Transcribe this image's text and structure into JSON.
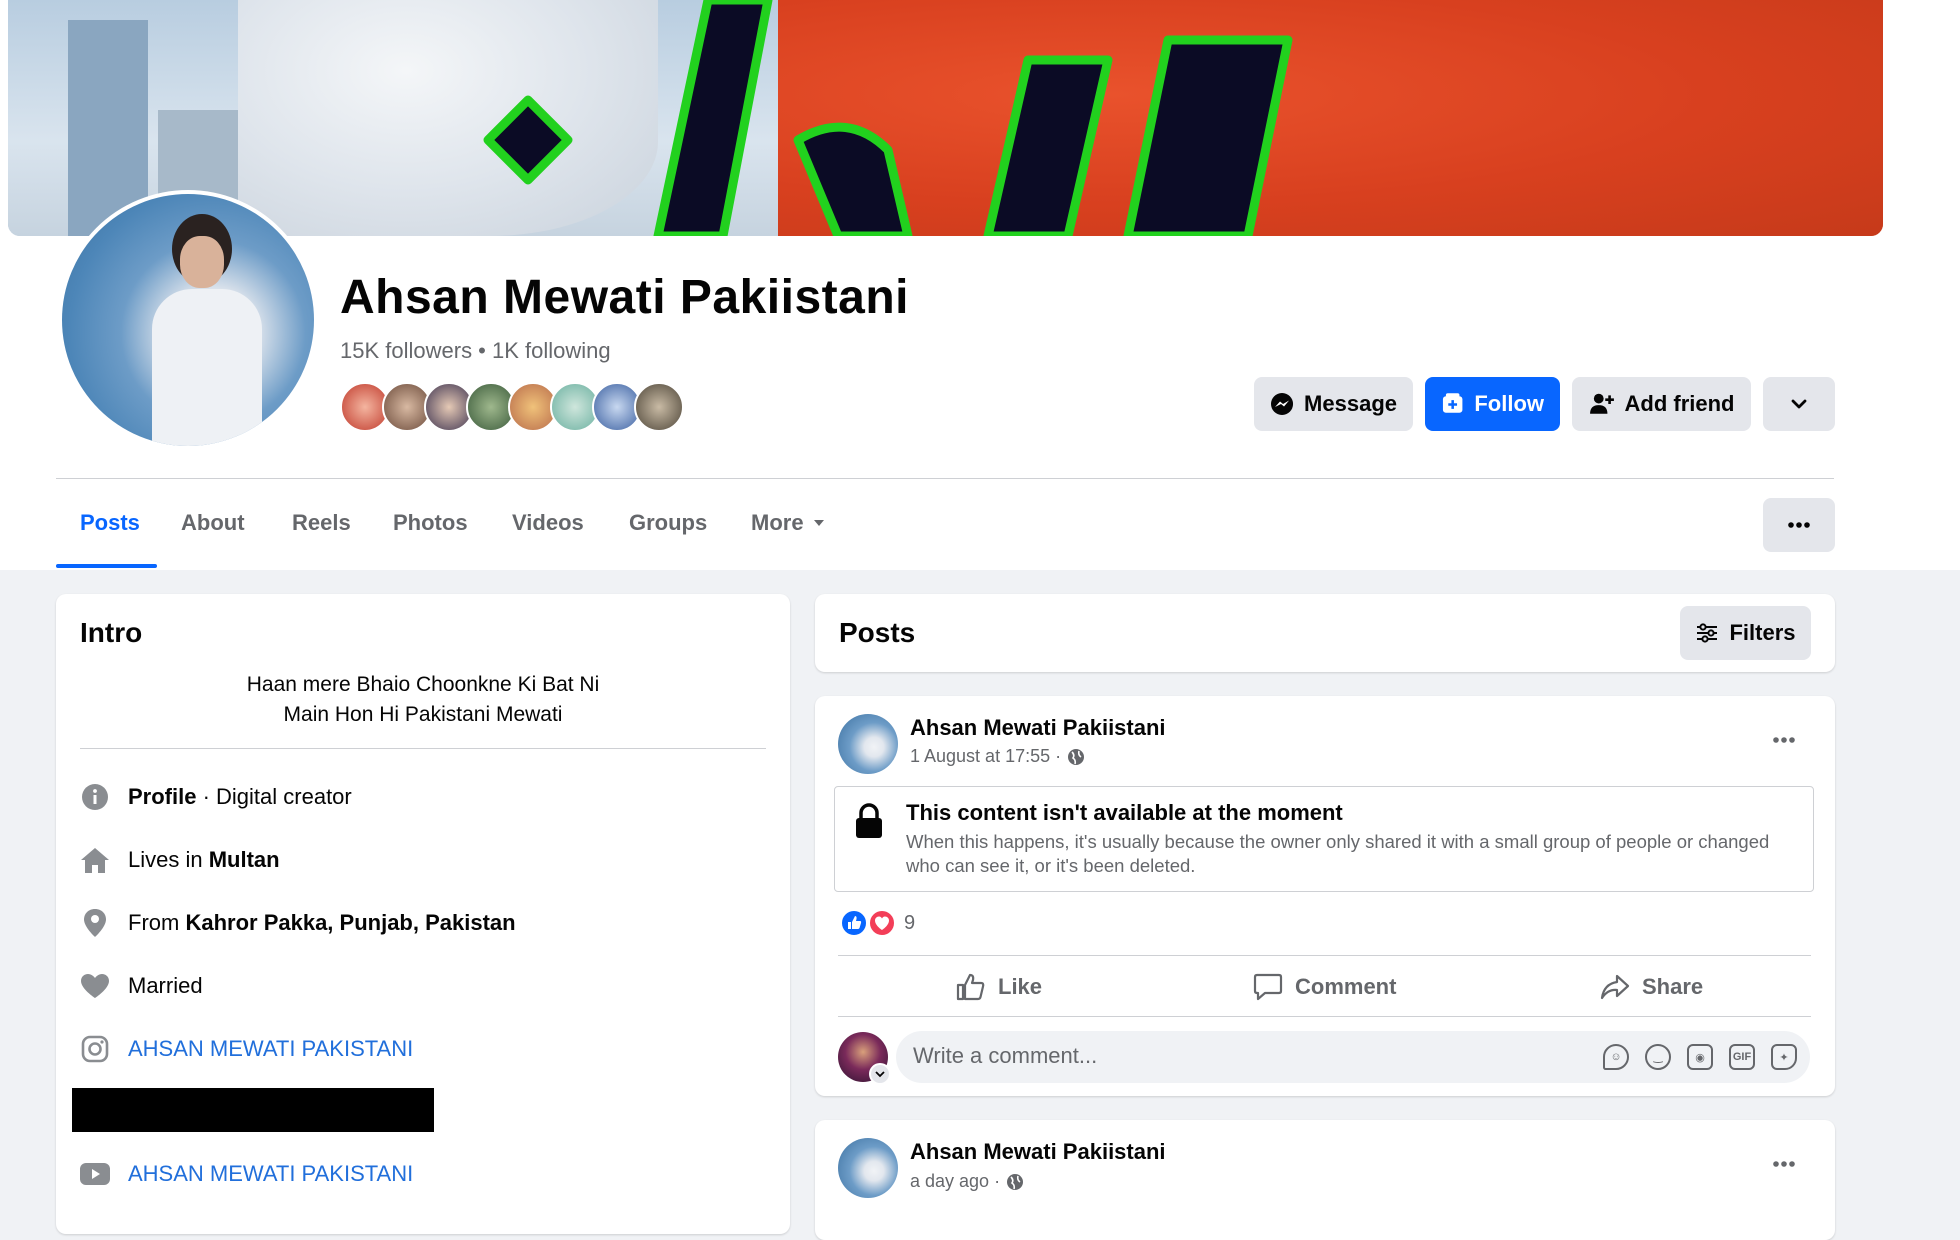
{
  "profile": {
    "name": "Ahsan Mewati Pakiistani",
    "followers_text": "15K followers • 1K following"
  },
  "actions": {
    "message_label": "Message",
    "follow_label": "Follow",
    "add_friend_label": "Add friend"
  },
  "tabs": [
    {
      "label": "Posts",
      "active": true
    },
    {
      "label": "About"
    },
    {
      "label": "Reels"
    },
    {
      "label": "Photos"
    },
    {
      "label": "Videos"
    },
    {
      "label": "Groups"
    },
    {
      "label": "More"
    }
  ],
  "intro": {
    "title": "Intro",
    "bio_line1": "Haan mere Bhaio Choonkne Ki Bat Ni",
    "bio_line2": "Main Hon Hi Pakistani Mewati",
    "profile_strong": "Profile",
    "profile_rest": " · Digital creator",
    "lives_prefix": "Lives in ",
    "lives_city": "Multan",
    "from_prefix": "From ",
    "from_place": "Kahror Pakka, Punjab, Pakistan",
    "relationship": "Married",
    "instagram": "AHSAN MEWATI PAKISTANI",
    "youtube": "AHSAN MEWATI PAKISTANI"
  },
  "posts": {
    "title": "Posts",
    "filters_label": "Filters",
    "items": [
      {
        "author": "Ahsan Mewati Pakiistani",
        "time": "1 August at 17:55 ·",
        "unavailable_title": "This content isn't available at the moment",
        "unavailable_text": "When this happens, it's usually because the owner only shared it with a small group of people or changed who can see it, or it's been deleted.",
        "reaction_count": "9",
        "like_label": "Like",
        "comment_label": "Comment",
        "share_label": "Share",
        "comment_placeholder": "Write a comment..."
      },
      {
        "author": "Ahsan Mewati Pakiistani",
        "time": "a day ago ·"
      }
    ]
  },
  "colors": {
    "accent": "#0866ff",
    "link": "#216fdb",
    "secondary_text": "#65676b"
  }
}
